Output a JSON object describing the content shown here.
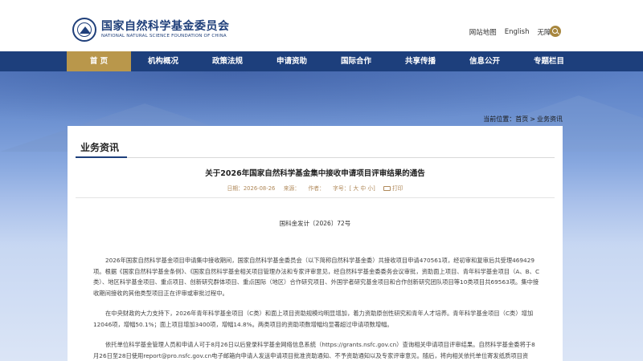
{
  "header": {
    "logo_cn": "国家自然科学基金委员会",
    "logo_en": "NATIONAL NATURAL SCIENCE FOUNDATION OF CHINA",
    "links": [
      "网站地图",
      "English",
      "无障碍"
    ]
  },
  "nav": {
    "items": [
      "首 页",
      "机构概况",
      "政策法规",
      "申请资助",
      "国际合作",
      "共享传播",
      "信息公开",
      "专题栏目"
    ],
    "active_index": 0
  },
  "breadcrumb": {
    "label": "当前位置：",
    "home": "首页",
    "sep": ">",
    "current": "业务资讯"
  },
  "section": {
    "title": "业务资讯"
  },
  "article": {
    "title": "关于2026年国家自然科学基金集中接收申请项目评审结果的通告",
    "date_label": "日期：",
    "date": "2026-08-26",
    "source_label": "来源：",
    "author_label": "作者：",
    "fontsize_label": "字号：",
    "bracket_open": "[",
    "size_large": "大",
    "size_medium": "中",
    "size_small": "小",
    "bracket_close": "]",
    "print_label": "打印",
    "doc_no": "国科金发计〔2026〕72号",
    "paragraphs": [
      "2026年国家自然科学基金项目申请集中接收期间，国家自然科学基金委员会（以下简称自然科学基金委）共接收项目申请470561项，经初审和复审后共受理469429项。根据《国家自然科学基金条例》、《国家自然科学基金相关项目管理办法和专家评审意见，经自然科学基金委委务会议审批，资助面上项目、青年科学基金项目（A、B、C类）、地区科学基金项目、重点项目、创新研究群体项目、重点国际（地区）合作研究项目、外国学者研究基金项目和合作创新研究团队项目等10类项目共69563项。集中接收期间接收的其他类型项目正在评审或审批过程中。",
      "在中央财政的大力支持下，2026年青年科学基金项目（C类）和面上项目资助规模均明显增加，着力资助原创性研究和青年人才培养。青年科学基金项目（C类）增加12046项，增幅50.1%；面上项目增加3400项，增幅14.8%。两类项目的资助项数增幅均显著超过申请项数增幅。",
      "依托单位科学基金管理人员和申请人可于8月26日以后登录科学基金网络信息系统（https://grants.nsfc.gov.cn）查询相关申请项目评审结果。自然科学基金委将于8月26日至28日使用report@pro.nsfc.gov.cn电子邮箱向申请人发送申请项目批准资助通知、不予资助通知以及专家评审意见。随后，将向相关依托单位寄发纸质项目资"
    ]
  },
  "colors": {
    "brand_blue": "#1d3f7c",
    "nav_active_gold": "#b9974b",
    "meta_gold": "#b0895a"
  },
  "icons": [
    "emblem-logo-icon",
    "search-icon",
    "print-icon"
  ]
}
